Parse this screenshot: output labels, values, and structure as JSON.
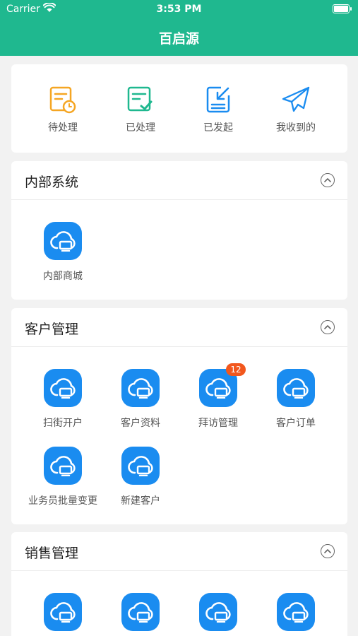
{
  "status_bar": {
    "carrier": "Carrier",
    "time": "3:53 PM"
  },
  "nav": {
    "title": "百启源"
  },
  "quick_actions": [
    {
      "label": "待处理",
      "icon": "pending-doc-clock-icon",
      "color": "#f5a623"
    },
    {
      "label": "已处理",
      "icon": "processed-doc-check-icon",
      "color": "#1fb88f"
    },
    {
      "label": "已发起",
      "icon": "initiated-doc-arrow-icon",
      "color": "#1a8cf0"
    },
    {
      "label": "我收到的",
      "icon": "paper-plane-icon",
      "color": "#1a8cf0"
    }
  ],
  "sections": [
    {
      "title": "内部系统",
      "apps": [
        {
          "label": "内部商城"
        }
      ]
    },
    {
      "title": "客户管理",
      "apps": [
        {
          "label": "扫街开户"
        },
        {
          "label": "客户资料"
        },
        {
          "label": "拜访管理",
          "badge": "12"
        },
        {
          "label": "客户订单"
        },
        {
          "label": "业务员批量变更"
        },
        {
          "label": "新建客户"
        }
      ]
    },
    {
      "title": "销售管理",
      "apps": []
    }
  ],
  "colors": {
    "brand": "#1fb88f",
    "app_icon": "#1a8cf0",
    "badge": "#f2571d"
  }
}
